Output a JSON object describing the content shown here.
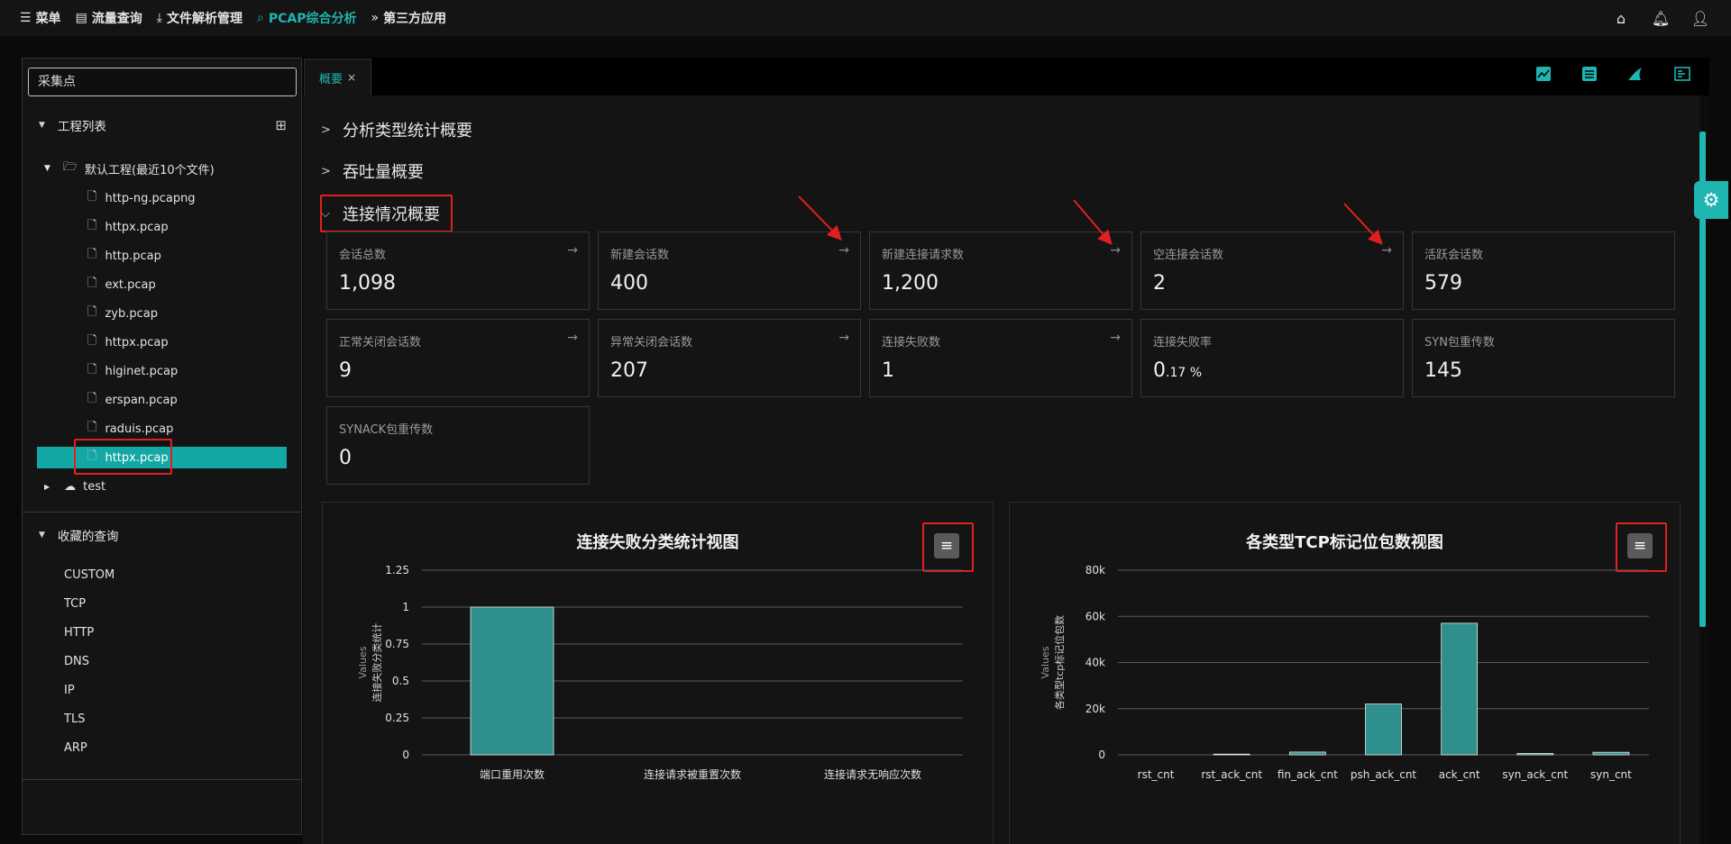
{
  "nav": {
    "items": [
      {
        "label": "菜单",
        "icon": "menu-icon"
      },
      {
        "label": "流量查询",
        "icon": "document-icon"
      },
      {
        "label": "文件解析管理",
        "icon": "upload-icon"
      },
      {
        "label": "PCAP综合分析",
        "icon": "search-icon"
      },
      {
        "label": "第三方应用",
        "icon": "double-chevron-icon"
      }
    ],
    "right_icons": [
      "home-icon",
      "bell-icon",
      "user-icon"
    ]
  },
  "sidebar": {
    "search_placeholder": "采集点",
    "project_list_title": "工程列表",
    "default_project": "默认工程(最近10个文件)",
    "files": [
      "http-ng.pcapng",
      "httpx.pcap",
      "http.pcap",
      "ext.pcap",
      "zyb.pcap",
      "httpx.pcap",
      "higinet.pcap",
      "erspan.pcap",
      "raduis.pcap",
      "httpx.pcap"
    ],
    "selected_file_index": 9,
    "other_project": "test",
    "favorites_title": "收藏的查询",
    "favorites": [
      "CUSTOM",
      "TCP",
      "HTTP",
      "DNS",
      "IP",
      "TLS",
      "ARP"
    ]
  },
  "tabs": [
    {
      "label": "概要",
      "close": "×"
    }
  ],
  "toolbar_icons": [
    "line-chart-icon",
    "table-icon",
    "shark-fin-icon",
    "list-view-icon"
  ],
  "sections": [
    {
      "title": "分析类型统计概要",
      "expanded": false
    },
    {
      "title": "吞吐量概要",
      "expanded": false
    },
    {
      "title": "连接情况概要",
      "expanded": true
    }
  ],
  "cards": [
    {
      "label": "会话总数",
      "value": "1,098",
      "unit": "",
      "arrow": true
    },
    {
      "label": "新建会话数",
      "value": "400",
      "unit": "",
      "arrow": true
    },
    {
      "label": "新建连接请求数",
      "value": "1,200",
      "unit": "",
      "arrow": true
    },
    {
      "label": "空连接会话数",
      "value": "2",
      "unit": "",
      "arrow": true
    },
    {
      "label": "活跃会话数",
      "value": "579",
      "unit": "",
      "arrow": false
    },
    {
      "label": "正常关闭会话数",
      "value": "9",
      "unit": "",
      "arrow": true
    },
    {
      "label": "异常关闭会话数",
      "value": "207",
      "unit": "",
      "arrow": true
    },
    {
      "label": "连接失败数",
      "value": "1",
      "unit": "",
      "arrow": true
    },
    {
      "label": "连接失败率",
      "value": "0",
      "unit": ".17 %",
      "arrow": false
    },
    {
      "label": "SYN包重传数",
      "value": "145",
      "unit": "",
      "arrow": false
    },
    {
      "label": "SYNACK包重传数",
      "value": "0",
      "unit": "",
      "arrow": false
    }
  ],
  "chart_data": [
    {
      "type": "bar",
      "title": "连接失败分类统计视图",
      "ylabel_values": "Values",
      "ylabel_series": "连接失败分类统计",
      "categories": [
        "端口重用次数",
        "连接请求被重置次数",
        "连接请求无响应次数"
      ],
      "values": [
        1,
        0,
        0
      ],
      "ylim": [
        0,
        1.25
      ],
      "yticks": [
        0,
        0.25,
        0.5,
        0.75,
        1,
        1.25
      ],
      "ytick_labels": [
        "0",
        "0.25",
        "0.5",
        "0.75",
        "1",
        "1.25"
      ],
      "color": "#2e8f8d"
    },
    {
      "type": "bar",
      "title": "各类型TCP标记位包数视图",
      "ylabel_values": "Values",
      "ylabel_series": "各类型tcp标记位包数",
      "categories": [
        "rst_cnt",
        "rst_ack_cnt",
        "fin_ack_cnt",
        "psh_ack_cnt",
        "ack_cnt",
        "syn_ack_cnt",
        "syn_cnt"
      ],
      "values": [
        0,
        300,
        1200,
        22000,
        57000,
        600,
        1100
      ],
      "ylim": [
        0,
        80000
      ],
      "yticks": [
        0,
        20000,
        40000,
        60000,
        80000
      ],
      "ytick_labels": [
        "0",
        "20k",
        "40k",
        "60k",
        "80k"
      ],
      "color": "#2e8f8d"
    }
  ],
  "colors": {
    "accent": "#1fb5b1",
    "annotation": "#e02020",
    "bar": "#2e8f8d"
  }
}
